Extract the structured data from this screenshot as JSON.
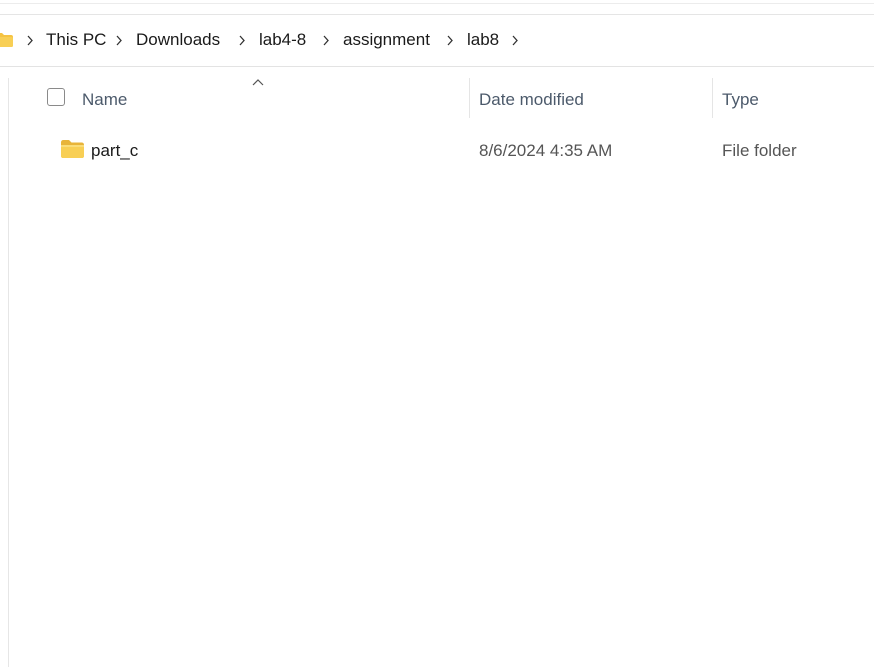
{
  "breadcrumb": {
    "items": [
      {
        "label": "This PC"
      },
      {
        "label": "Downloads"
      },
      {
        "label": "lab4-8"
      },
      {
        "label": "assignment"
      },
      {
        "label": "lab8"
      }
    ]
  },
  "columns": {
    "name": "Name",
    "date_modified": "Date modified",
    "type": "Type",
    "sorted_by": "Name",
    "sort_direction": "ascending"
  },
  "files": [
    {
      "name": "part_c",
      "date_modified": "8/6/2024 4:35 AM",
      "type": "File folder",
      "icon": "folder-icon"
    }
  ],
  "colors": {
    "folder_yellow": "#f5c342",
    "folder_dark": "#e0a92a",
    "header_text": "#4c5a6b"
  }
}
